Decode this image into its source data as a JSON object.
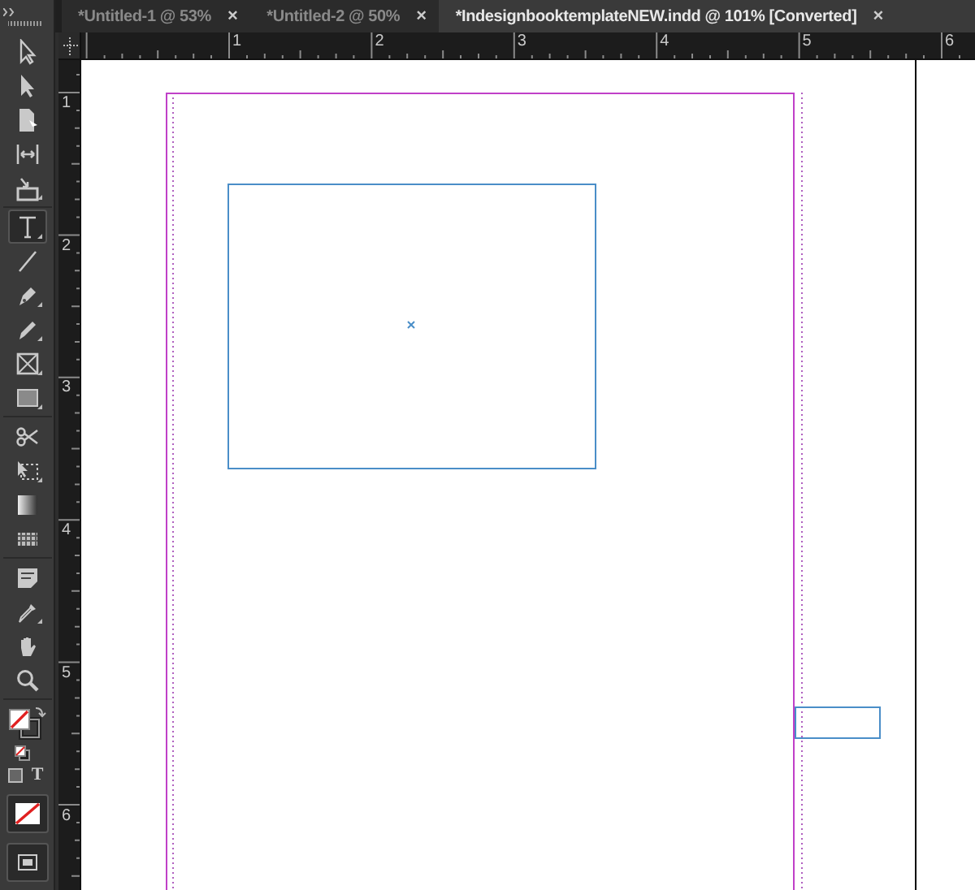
{
  "tabs": [
    {
      "label": "*Untitled-1 @ 53%",
      "close": "×",
      "selected": false
    },
    {
      "label": "*Untitled-2 @ 50%",
      "close": "×",
      "selected": false
    },
    {
      "label": "*IndesignbooktemplateNEW.indd @ 101% [Converted]",
      "close": "×",
      "selected": true
    }
  ],
  "tool_groups": [
    [
      {
        "selected": false
      },
      {
        "selected": false
      },
      {
        "selected": false
      },
      {
        "selected": false
      },
      {
        "selected": false
      }
    ],
    [
      {
        "selected": true
      },
      {
        "selected": false
      },
      {
        "selected": false
      },
      {
        "selected": false
      },
      {
        "selected": false
      },
      {
        "selected": false
      }
    ],
    [
      {
        "selected": false
      },
      {
        "selected": false
      },
      {
        "selected": false
      },
      {
        "selected": false
      }
    ],
    [
      {
        "selected": false
      },
      {
        "selected": false
      },
      {
        "selected": false
      },
      {
        "selected": false
      }
    ]
  ],
  "formatting_text_button": "T",
  "horizontal_ruler": {
    "labels": [
      "1",
      "2",
      "3",
      "4",
      "5",
      "6"
    ]
  },
  "vertical_ruler": {
    "labels": [
      "1",
      "2",
      "3",
      "4",
      "5",
      "6"
    ]
  }
}
